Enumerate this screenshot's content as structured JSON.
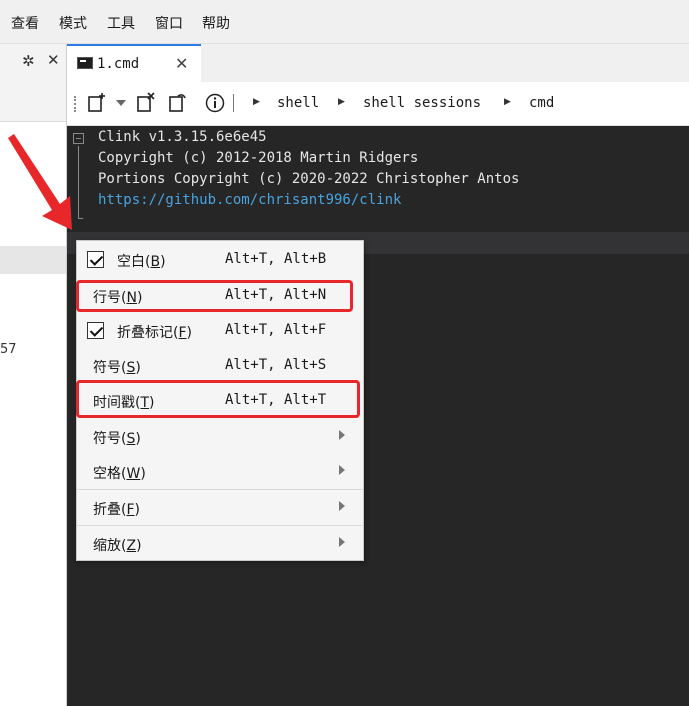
{
  "menubar": {
    "items": [
      "查看",
      "模式",
      "工具",
      "窗口",
      "帮助"
    ]
  },
  "leftpanel": {
    "number_text": "57"
  },
  "tab": {
    "title": "1.cmd"
  },
  "breadcrumb": [
    "shell",
    "shell sessions",
    "cmd"
  ],
  "terminal": {
    "lines": [
      "Clink v1.3.15.6e6e45",
      "Copyright (c) 2012-2018 Martin Ridgers",
      "Portions Copyright (c) 2020-2022 Christopher Antos",
      "https://github.com/chrisant996/clink"
    ]
  },
  "context_menu": {
    "items": [
      {
        "label": "空白(",
        "key": "B",
        "suffix": ")",
        "shortcut": "Alt+T, Alt+B",
        "checked": true
      },
      {
        "label": "行号(",
        "key": "N",
        "suffix": ")",
        "shortcut": "Alt+T, Alt+N",
        "checked": false
      },
      {
        "label": "折叠标记(",
        "key": "F",
        "suffix": ")",
        "shortcut": "Alt+T, Alt+F",
        "checked": true
      },
      {
        "label": "符号(",
        "key": "S",
        "suffix": ")",
        "shortcut": "Alt+T, Alt+S",
        "checked": false
      },
      {
        "label": "时间戳(",
        "key": "T",
        "suffix": ")",
        "shortcut": "Alt+T, Alt+T",
        "checked": false
      },
      {
        "label": "符号(",
        "key": "S",
        "suffix": ")",
        "submenu": true
      },
      {
        "label": "空格(",
        "key": "W",
        "suffix": ")",
        "submenu": true
      },
      {
        "label": "折叠(",
        "key": "F",
        "suffix": ")",
        "submenu": true
      },
      {
        "label": "缩放(",
        "key": "Z",
        "suffix": ")",
        "submenu": true
      }
    ]
  },
  "colors": {
    "highlight": "#e8272a",
    "terminal_bg": "#262626",
    "link": "#4aa3df",
    "tab_accent": "#2f7ae5"
  }
}
